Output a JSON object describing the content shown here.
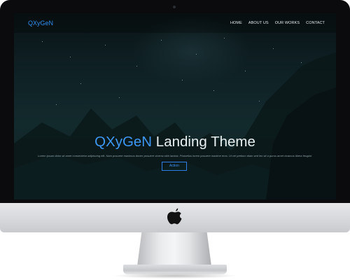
{
  "nav": {
    "brand": "QXyGeN",
    "items": [
      {
        "label": "HOME"
      },
      {
        "label": "ABOUT US"
      },
      {
        "label": "OUR WORKS"
      },
      {
        "label": "CONTACT"
      }
    ]
  },
  "hero": {
    "title_accent": "QXyGeN",
    "title_rest": " Landing Theme",
    "subtitle": "Lorem ipsum dolor sit amet consectetur adipiscing elit. Nam posuere maximus donec posuere viverra nibh lacinia. Phasellus lorem posuere maxime eros. Ut vel pretium diam sed leo sit a purus amet vivamus libera feugiat.",
    "action_label": "Action"
  },
  "device": {
    "logo_icon": "apple-icon"
  },
  "colors": {
    "accent": "#2f8ff0",
    "bezel": "#0b0b0d",
    "chin": "#d7d8db"
  }
}
